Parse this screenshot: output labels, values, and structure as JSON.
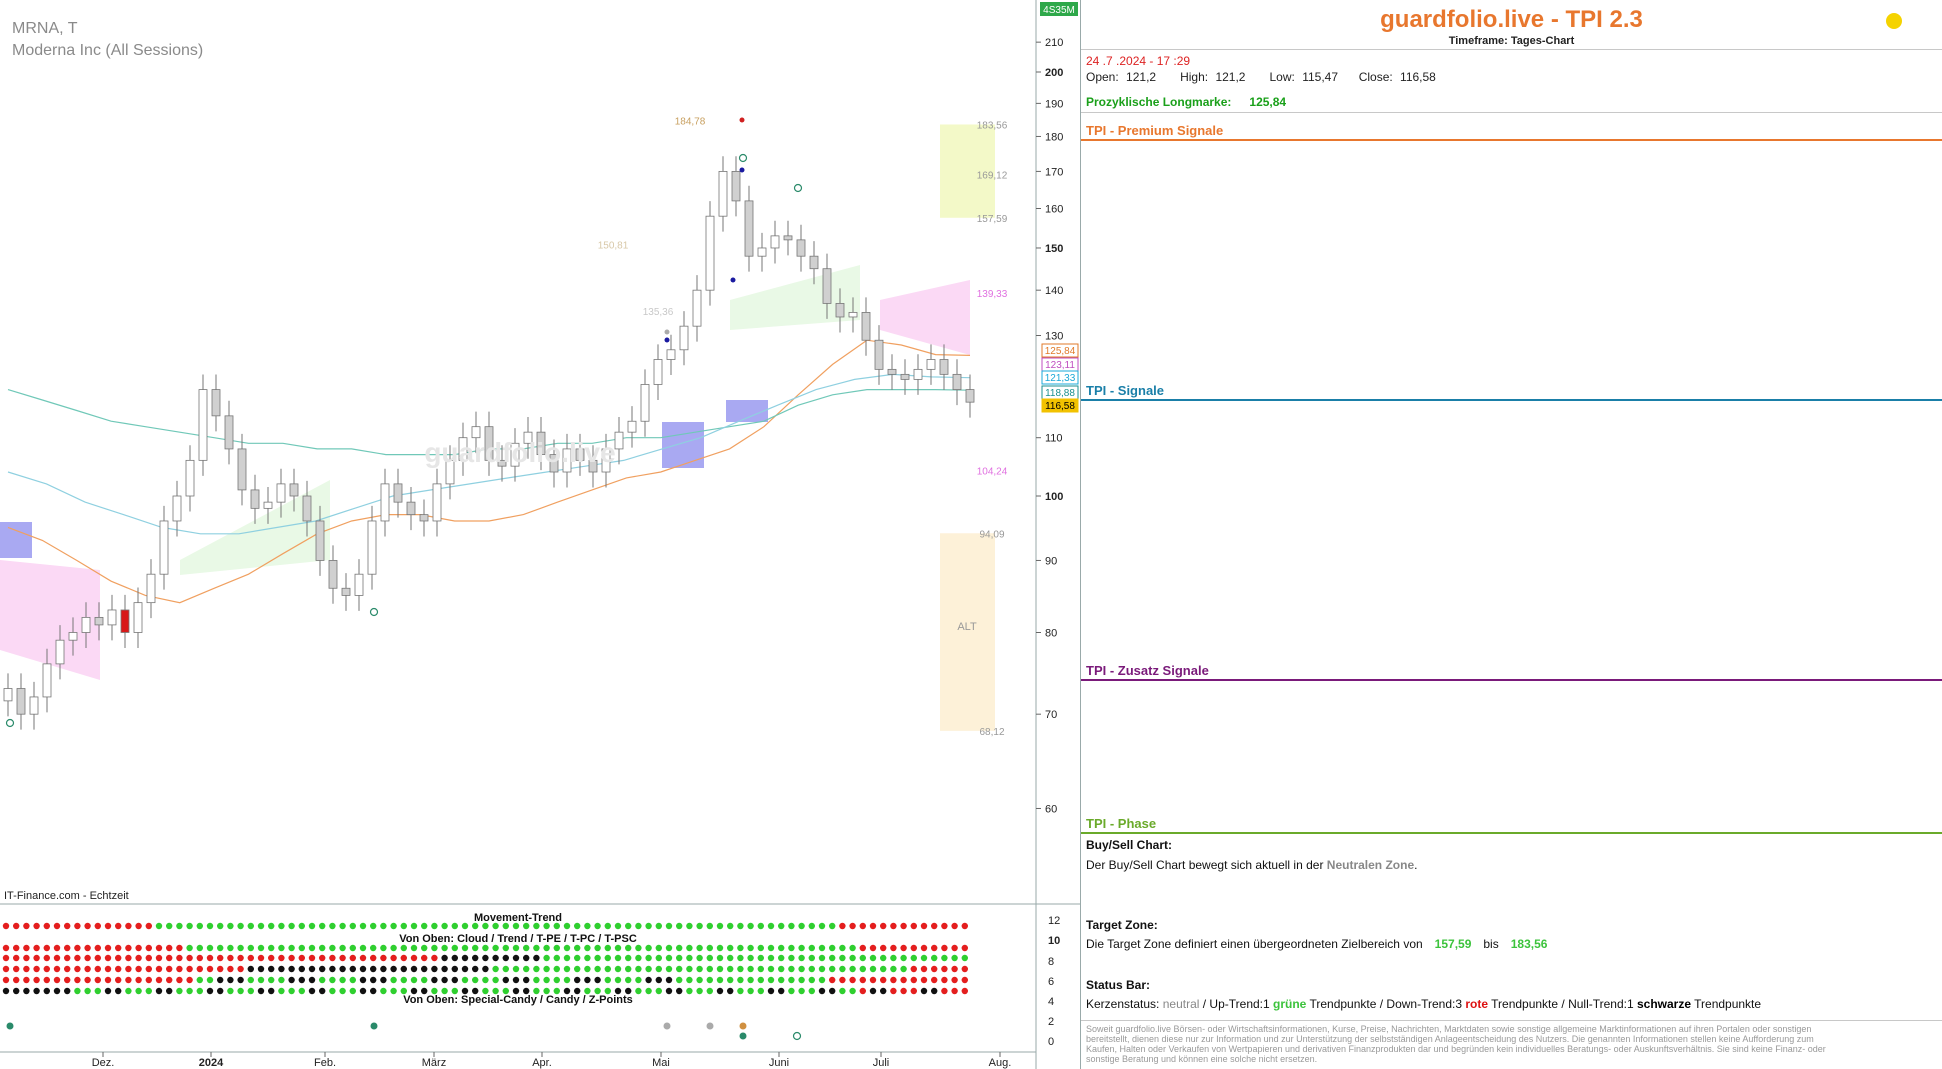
{
  "header": {
    "symbol": "MRNA, T",
    "company": "Moderna Inc (All Sessions)",
    "source": "IT-Finance.com - Echtzeit",
    "corner_badge": "4S35M",
    "watermark": "guardfolio.live"
  },
  "chart_data": {
    "type": "candlestick",
    "y_scale": "log",
    "ylim": [
      57,
      220
    ],
    "y_ticks": [
      "210",
      "200",
      "190",
      "180",
      "170",
      "160",
      "150",
      "140",
      "130",
      "110",
      "100",
      "90",
      "80",
      "70",
      "60"
    ],
    "x_ticks": [
      "Dez.",
      "2024",
      "Feb.",
      "März",
      "Apr.",
      "Mai",
      "Juni",
      "Juli",
      "Aug."
    ],
    "price_tags": [
      {
        "value": "125,84",
        "color": "#e07a2a"
      },
      {
        "value": "123,11",
        "color": "#c04dc0"
      },
      {
        "value": "121,33",
        "color": "#1aa8d8"
      },
      {
        "value": "118,88",
        "color": "#1a8f8f"
      },
      {
        "value": "116,58",
        "color": "#f2c200"
      }
    ],
    "level_labels": [
      {
        "text": "184,78",
        "value": 184.78,
        "color": "#c8a060"
      },
      {
        "text": "183,56",
        "value": 183.56,
        "color": "#999999"
      },
      {
        "text": "169,12",
        "value": 169.12,
        "color": "#999999"
      },
      {
        "text": "157,59",
        "value": 157.59,
        "color": "#999999"
      },
      {
        "text": "150,81",
        "value": 150.81,
        "color": "#d8c8a8"
      },
      {
        "text": "139,33",
        "value": 139.33,
        "color": "#e070e0"
      },
      {
        "text": "135,36",
        "value": 135.36,
        "color": "#c8c8c8"
      },
      {
        "text": "104,24",
        "value": 104.24,
        "color": "#e070e0"
      },
      {
        "text": "94,09",
        "value": 94.09,
        "color": "#999999"
      },
      {
        "text": "68,12",
        "value": 68.12,
        "color": "#999999"
      }
    ],
    "target_zone_label": "ALT",
    "close_series": [
      73,
      70,
      72,
      76,
      79,
      80,
      82,
      81,
      83,
      80,
      84,
      88,
      96,
      100,
      106,
      119,
      114,
      108,
      101,
      98,
      99,
      102,
      100,
      96,
      90,
      86,
      85,
      88,
      96,
      102,
      99,
      97,
      96,
      102,
      106,
      110,
      112,
      106,
      105,
      109,
      111,
      107,
      104,
      108,
      106,
      104,
      108,
      111,
      113,
      120,
      125,
      127,
      132,
      140,
      158,
      170,
      162,
      148,
      150,
      153,
      152,
      148,
      145,
      137,
      134,
      135,
      129,
      123,
      122,
      121,
      123,
      125,
      122,
      119,
      116.58
    ],
    "ma_series": [
      {
        "name": "ma-orange",
        "color": "#f0a060",
        "values": [
          95,
          93,
          90,
          87,
          85,
          84,
          86,
          88,
          91,
          94,
          96,
          97,
          97,
          96,
          96,
          97,
          99,
          101,
          103,
          104,
          106,
          108,
          112,
          118,
          124,
          129,
          128,
          126,
          125.84
        ]
      },
      {
        "name": "ma-teal",
        "color": "#70c8b8",
        "values": [
          119,
          117,
          115,
          113,
          112,
          111,
          110,
          109,
          109,
          108,
          108,
          107,
          107,
          107,
          108,
          108,
          109,
          109,
          110,
          110,
          111,
          112,
          113,
          116,
          118,
          119,
          119,
          119,
          118.88
        ]
      },
      {
        "name": "ma-cyan",
        "color": "#8fd0e0",
        "values": [
          104,
          102,
          99,
          97,
          95,
          94,
          94,
          95,
          96,
          98,
          100,
          101,
          102,
          103,
          104,
          105,
          106,
          108,
          110,
          113,
          116,
          119,
          121,
          122,
          121.5,
          121.33
        ]
      }
    ]
  },
  "movement": {
    "title": "Movement-Trend",
    "subtitle1": "Von Oben: Cloud / Trend / T-PE / T-PC / T-PSC",
    "subtitle2": "Von Oben: Special-Candy / Candy / Z-Points",
    "y_ticks": [
      "12",
      "10",
      "8",
      "6",
      "4",
      "2",
      "0"
    ]
  },
  "info": {
    "brand": "guardfolio.live - TPI 2.3",
    "timeframe": "Timeframe: Tages-Chart",
    "datetime": "24 .7 .2024  - 17 :29",
    "open_label": "Open:",
    "open": "121,2",
    "high_label": "High:",
    "high": "121,2",
    "low_label": "Low:",
    "low": "115,47",
    "close_label": "Close:",
    "close": "116,58",
    "longmarke_label": "Prozyklische Longmarke:",
    "longmarke": "125,84",
    "premium_title": "TPI - Premium Signale",
    "signale_title": "TPI - Signale",
    "zusatz_title": "TPI - Zusatz Signale",
    "phase_title": "TPI - Phase",
    "buysell_h": "Buy/Sell Chart:",
    "buysell_t1": "Der Buy/Sell Chart bewegt sich aktuell in der ",
    "buysell_zone": "Neutralen Zone",
    "buysell_t2": ".",
    "target_h": "Target Zone:",
    "target_t1": "Die Target Zone definiert einen übergeordneten Zielbereich von",
    "target_lo": "157,59",
    "target_mid": "bis",
    "target_hi": "183,56",
    "status_h": "Status Bar:",
    "status_a": "Kerzenstatus:",
    "status_neutral": "neutral",
    "status_b": " / Up-Trend:1 ",
    "status_green": "grüne",
    "status_c": " Trendpunkte  / Down-Trend:3 ",
    "status_red": "rote",
    "status_d": " Trendpunkte / Null-Trend:1 ",
    "status_black": "schwarze",
    "status_e": " Trendpunkte",
    "disclaimer": "Soweit guardfolio.live Börsen- oder Wirtschaftsinformationen, Kurse, Preise, Nachrichten, Marktdaten sowie sonstige allgemeine Marktinformationen auf ihren Portalen oder sonstigen bereitstellt, dienen diese nur zur Information und zur Unterstützung der selbstständigen Anlageentscheidung des Nutzers. Die genannten Informationen stellen keine Aufforderung zum Kaufen, Halten oder Verkaufen von Wertpapieren und derivativen Finanzprodukten dar und begründen kein individuelles Beratungs- oder Auskunftsverhältnis. Sie sind keine Finanz- oder sonstige Beratung und können eine solche nicht ersetzen."
  }
}
